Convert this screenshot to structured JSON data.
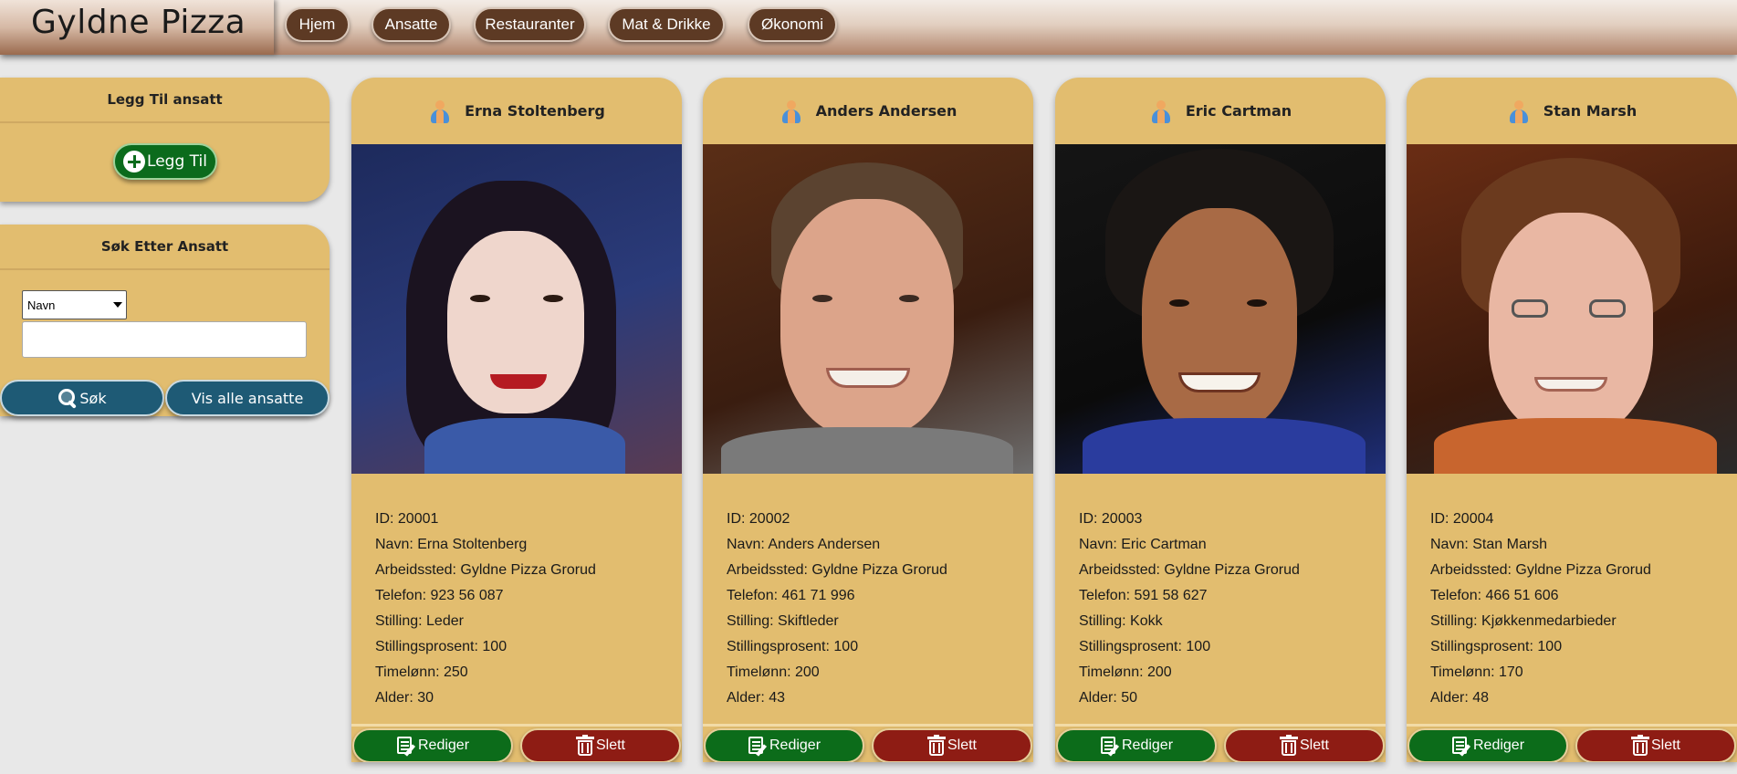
{
  "app": {
    "brand": "Gyldne Pizza"
  },
  "nav": {
    "items": [
      {
        "label": "Hjem"
      },
      {
        "label": "Ansatte"
      },
      {
        "label": "Restauranter"
      },
      {
        "label": "Mat & Drikke"
      },
      {
        "label": "Økonomi"
      }
    ]
  },
  "sidebar": {
    "add_panel": {
      "title": "Legg Til ansatt",
      "button_label": "Legg Til"
    },
    "search_panel": {
      "title": "Søk Etter Ansatt",
      "select_value": "Navn",
      "input_value": "",
      "search_label": "Søk",
      "show_all_label": "Vis alle ansatte"
    }
  },
  "card_labels": {
    "id": "ID: ",
    "name": "Navn: ",
    "workplace": "Arbeidssted: ",
    "phone": "Telefon: ",
    "position": "Stilling: ",
    "percent": "Stillingsprosent: ",
    "wage": "Timelønn: ",
    "age": "Alder: ",
    "edit": "Rediger",
    "delete": "Slett"
  },
  "employees": [
    {
      "name": "Erna Stoltenberg",
      "id": "20001",
      "workplace": "Gyldne Pizza Grorud",
      "phone": "923 56 087",
      "position": "Leder",
      "percent": "100",
      "wage": "250",
      "age": "30"
    },
    {
      "name": "Anders Andersen",
      "id": "20002",
      "workplace": "Gyldne Pizza Grorud",
      "phone": "461 71 996",
      "position": "Skiftleder",
      "percent": "100",
      "wage": "200",
      "age": "43"
    },
    {
      "name": "Eric Cartman",
      "id": "20003",
      "workplace": "Gyldne Pizza Grorud",
      "phone": "591 58 627",
      "position": "Kokk",
      "percent": "100",
      "wage": "200",
      "age": "50"
    },
    {
      "name": "Stan Marsh",
      "id": "20004",
      "workplace": "Gyldne Pizza Grorud",
      "phone": "466 51 606",
      "position": "Kjøkkenmedarbieder",
      "percent": "100",
      "wage": "170",
      "age": "48"
    }
  ],
  "colors": {
    "card_bg": "#e2bd6f",
    "nav_btn": "#5d3a24",
    "edit_green": "#0c6c1a",
    "delete_red": "#8e1c14",
    "search_blue": "#1e5a75"
  }
}
